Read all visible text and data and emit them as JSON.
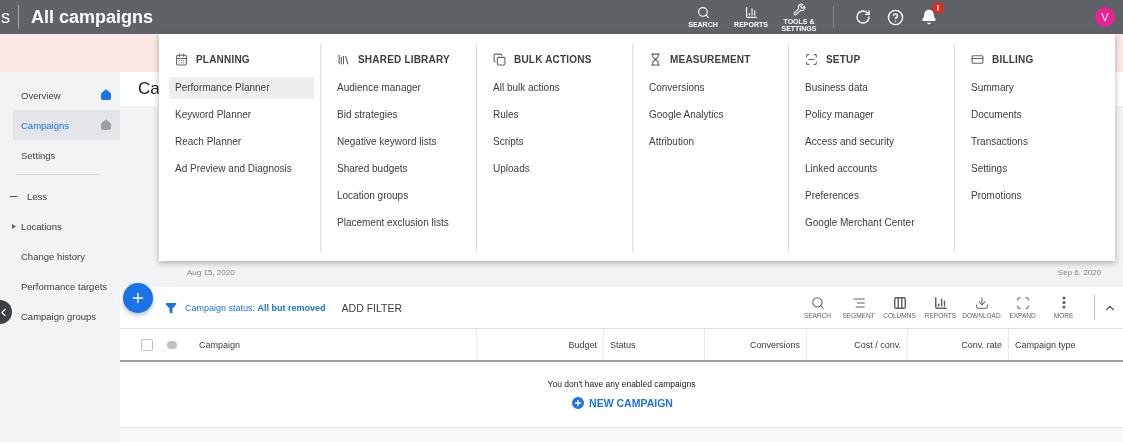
{
  "top_bar": {
    "breadcrumb": "s",
    "title": "All campaigns",
    "tools": [
      {
        "label": "SEARCH"
      },
      {
        "label": "REPORTS"
      },
      {
        "label": "TOOLS & SETTINGS"
      }
    ],
    "notification_badge": "!",
    "avatar": "V"
  },
  "sidebar": {
    "items": [
      {
        "kind": "nav",
        "label": "Overview",
        "selected": false,
        "pinned": true
      },
      {
        "kind": "nav",
        "label": "Campaigns",
        "selected": true,
        "pinned": false
      },
      {
        "kind": "nav",
        "label": "Settings",
        "selected": false
      },
      {
        "kind": "divider"
      },
      {
        "kind": "toggle",
        "label": "Less"
      },
      {
        "kind": "group",
        "label": "Locations",
        "selected": false
      },
      {
        "kind": "nav",
        "label": "Change history",
        "selected": false
      },
      {
        "kind": "nav",
        "label": "Performance targets",
        "selected": false
      },
      {
        "kind": "nav",
        "label": "Campaign groups",
        "selected": false
      }
    ]
  },
  "content": {
    "page_title": "Ca",
    "date_start": "Aug 15, 2020",
    "date_end": "Sep 6, 2020",
    "filter": {
      "text": "Campaign status: **All but removed**",
      "add": "ADD FILTER"
    },
    "toolbar": [
      {
        "label": "SEARCH"
      },
      {
        "label": "SEGMENT"
      },
      {
        "label": "COLUMNS"
      },
      {
        "label": "REPORTS"
      },
      {
        "label": "DOWNLOAD"
      },
      {
        "label": "EXPAND"
      },
      {
        "label": "MORE"
      }
    ],
    "table": {
      "columns": [
        {
          "label": "Campaign"
        },
        {
          "label": "Budget"
        },
        {
          "label": "Status"
        },
        {
          "label": "Conversions"
        },
        {
          "label": "Cost / conv."
        },
        {
          "label": "Conv. rate"
        },
        {
          "label": "Campaign type"
        }
      ],
      "header_checked": false,
      "empty_message": "You don't have any enabled campaigns",
      "new_campaign": "NEW CAMPAIGN"
    }
  },
  "tools_menu": {
    "sections": [
      {
        "title": "PLANNING",
        "items": [
          {
            "label": "Performance Planner",
            "selected": true
          },
          {
            "label": "Keyword Planner",
            "selected": false
          },
          {
            "label": "Reach Planner",
            "selected": false
          },
          {
            "label": "Ad Preview and Diagnosis",
            "selected": false
          }
        ]
      },
      {
        "title": "SHARED LIBRARY",
        "items": [
          {
            "label": "Audience manager",
            "selected": false
          },
          {
            "label": "Bid strategies",
            "selected": false
          },
          {
            "label": "Negative keyword lists",
            "selected": false
          },
          {
            "label": "Shared budgets",
            "selected": false
          },
          {
            "label": "Location groups",
            "selected": false
          },
          {
            "label": "Placement exclusion lists",
            "selected": false
          }
        ]
      },
      {
        "title": "BULK ACTIONS",
        "items": [
          {
            "label": "All bulk actions",
            "selected": false
          },
          {
            "label": "Rules",
            "selected": false
          },
          {
            "label": "Scripts",
            "selected": false
          },
          {
            "label": "Uploads",
            "selected": false
          }
        ]
      },
      {
        "title": "MEASUREMENT",
        "items": [
          {
            "label": "Conversions",
            "selected": false
          },
          {
            "label": "Google Analytics",
            "selected": false
          },
          {
            "label": "Attribution",
            "selected": false
          }
        ]
      },
      {
        "title": "SETUP",
        "items": [
          {
            "label": "Business data",
            "selected": false
          },
          {
            "label": "Policy manager",
            "selected": false
          },
          {
            "label": "Access and security",
            "selected": false
          },
          {
            "label": "Linked accounts",
            "selected": false
          },
          {
            "label": "Preferences",
            "selected": false
          },
          {
            "label": "Google Merchant Center",
            "selected": false
          }
        ]
      },
      {
        "title": "BILLING",
        "items": [
          {
            "label": "Summary",
            "selected": false
          },
          {
            "label": "Documents",
            "selected": false
          },
          {
            "label": "Transactions",
            "selected": false
          },
          {
            "label": "Settings",
            "selected": false
          },
          {
            "label": "Promotions",
            "selected": false
          }
        ]
      }
    ]
  }
}
